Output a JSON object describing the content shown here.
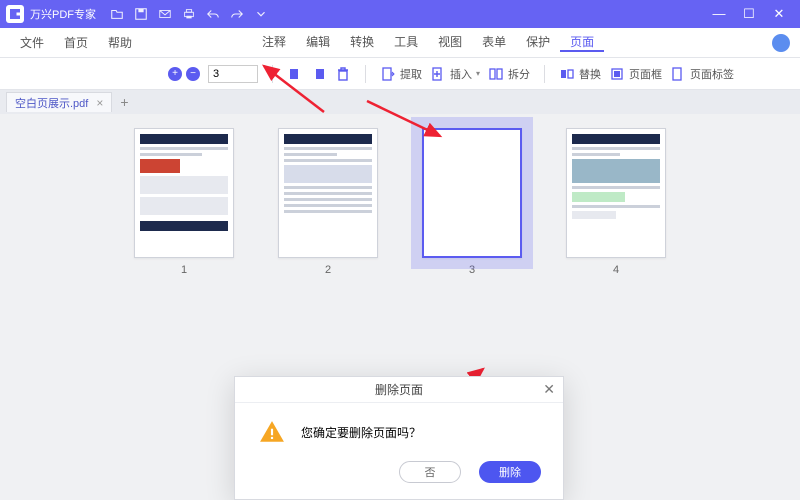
{
  "app": {
    "title": "万兴PDF专家"
  },
  "win": {
    "min": "—",
    "max": "☐",
    "close": "✕"
  },
  "menu_left": [
    "文件",
    "首页",
    "帮助"
  ],
  "menu_center": [
    "注释",
    "编辑",
    "转换",
    "工具",
    "视图",
    "表单",
    "保护",
    "页面"
  ],
  "menu_active_index": 7,
  "toolbar": {
    "page_value": "3",
    "extract": "提取",
    "insert": "插入",
    "split": "拆分",
    "replace": "替换",
    "pagebox": "页面框",
    "pagelabel": "页面标签"
  },
  "tab": {
    "name": "空白页展示.pdf"
  },
  "thumbs": [
    {
      "n": "1",
      "sel": false
    },
    {
      "n": "2",
      "sel": false
    },
    {
      "n": "3",
      "sel": true
    },
    {
      "n": "4",
      "sel": false
    }
  ],
  "dialog": {
    "title": "删除页面",
    "msg": "您确定要删除页面吗？",
    "no": "否",
    "del": "删除"
  }
}
